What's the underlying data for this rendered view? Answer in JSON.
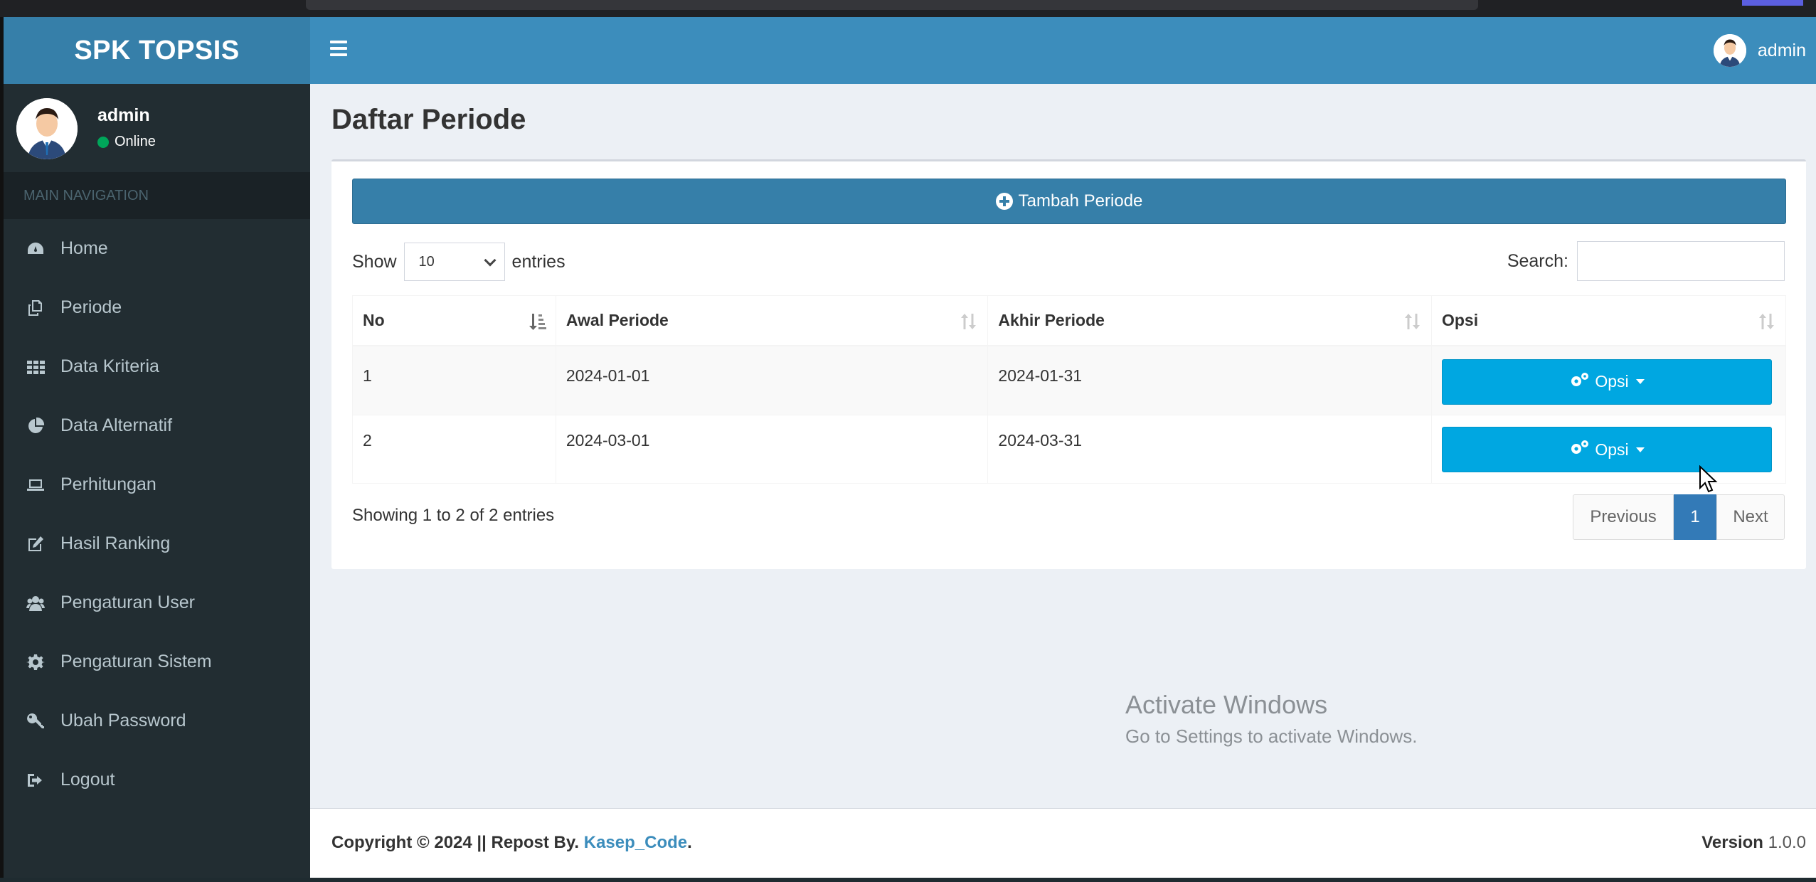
{
  "brand": {
    "title": "SPK TOPSIS"
  },
  "user": {
    "name": "admin",
    "status": "Online"
  },
  "topbar": {
    "user_name": "admin"
  },
  "sidebar": {
    "header": "MAIN NAVIGATION",
    "items": [
      {
        "label": "Home",
        "icon": "dashboard-icon"
      },
      {
        "label": "Periode",
        "icon": "copy-icon"
      },
      {
        "label": "Data Kriteria",
        "icon": "grid-icon"
      },
      {
        "label": "Data Alternatif",
        "icon": "pie-chart-icon"
      },
      {
        "label": "Perhitungan",
        "icon": "laptop-icon"
      },
      {
        "label": "Hasil Ranking",
        "icon": "edit-icon"
      },
      {
        "label": "Pengaturan User",
        "icon": "users-icon"
      },
      {
        "label": "Pengaturan Sistem",
        "icon": "gear-icon"
      },
      {
        "label": "Ubah Password",
        "icon": "key-icon"
      },
      {
        "label": "Logout",
        "icon": "sign-out-icon"
      }
    ]
  },
  "page": {
    "title": "Daftar Periode"
  },
  "box": {
    "add_button": "Tambah Periode",
    "show_label": "Show",
    "entries_label": "entries",
    "page_length": "10",
    "search_label": "Search:",
    "search_value": ""
  },
  "table": {
    "columns": [
      "No",
      "Awal Periode",
      "Akhir Periode",
      "Opsi"
    ],
    "rows": [
      {
        "no": "1",
        "awal": "2024-01-01",
        "akhir": "2024-01-31",
        "opsi": "Opsi"
      },
      {
        "no": "2",
        "awal": "2024-03-01",
        "akhir": "2024-03-31",
        "opsi": "Opsi"
      }
    ]
  },
  "pagination": {
    "info": "Showing 1 to 2 of 2 entries",
    "previous": "Previous",
    "current": "1",
    "next": "Next"
  },
  "watermark": {
    "line1": "Activate Windows",
    "line2": "Go to Settings to activate Windows."
  },
  "footer": {
    "copyright": "Copyright © 2024 || Repost By. ",
    "link": "Kasep_Code",
    "period": ".",
    "version_label": "Version",
    "version": "1.0.0"
  },
  "colors": {
    "sidebar_bg": "#222d32",
    "header_bg": "#3c8dbc",
    "logo_bg": "#367fa9",
    "opsi_button": "#00a7e1",
    "pagination_active": "#337ab7"
  }
}
